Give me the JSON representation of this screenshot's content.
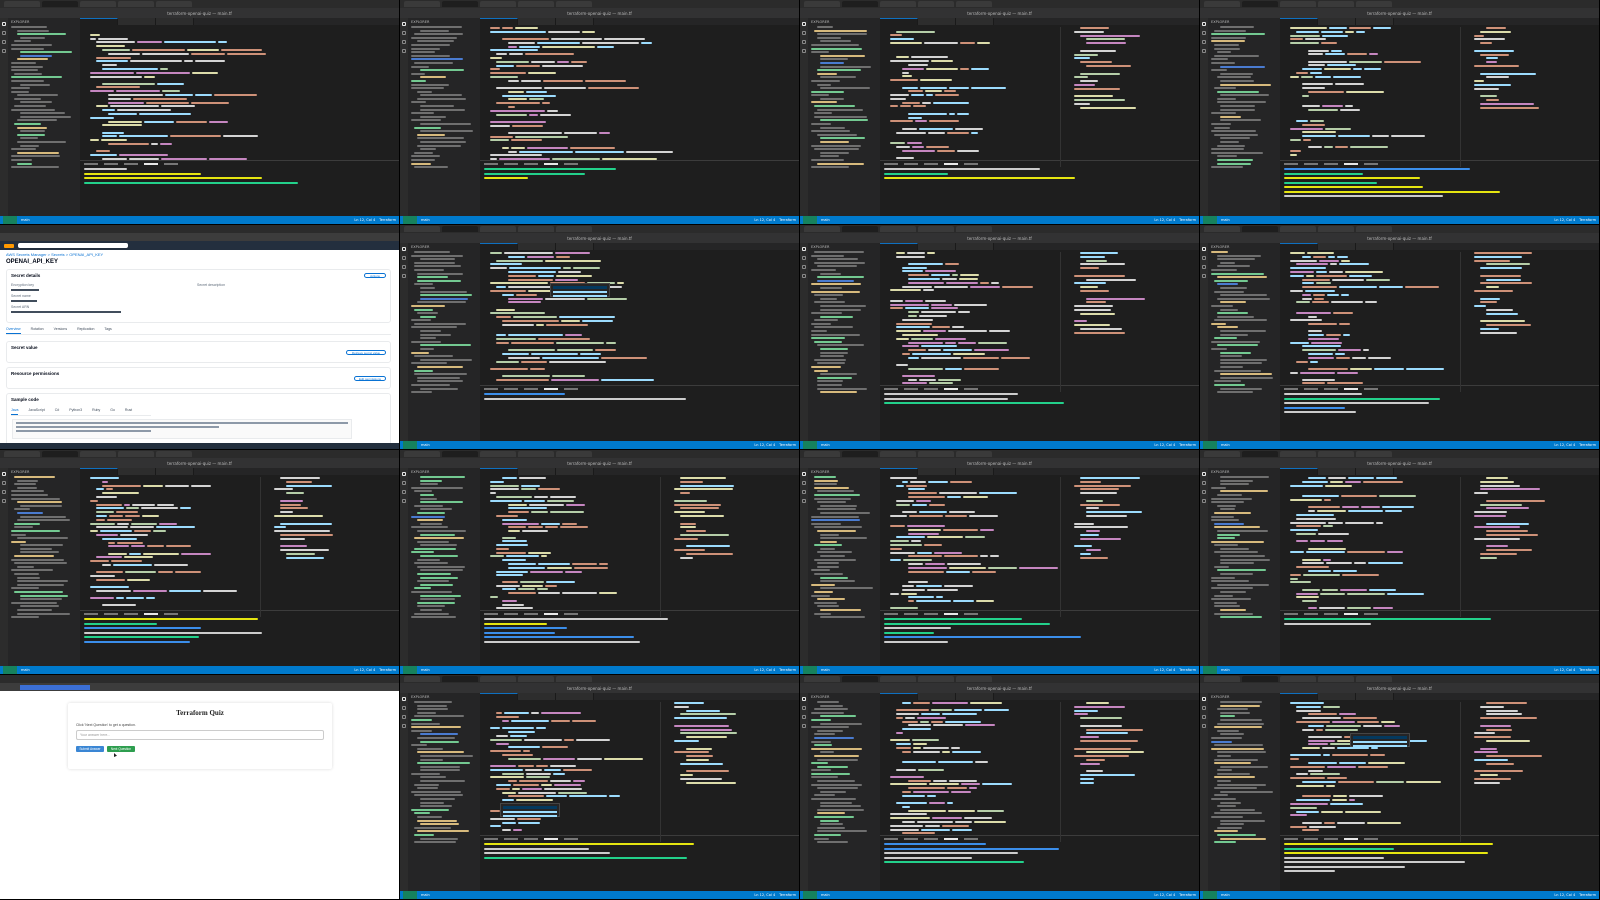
{
  "vscode": {
    "window_title": "terraform-openai-quiz — main.tf",
    "explorer_header": "EXPLORER",
    "status_branch": "main",
    "status_position": "Ln 12, Col 4",
    "status_lang": "Terraform"
  },
  "secret_page": {
    "breadcrumb": "AWS Secrets Manager > Secrets > OPENAI_API_KEY",
    "title": "OPENAI_API_KEY",
    "secret_details_title": "Secret details",
    "encryption_key_label": "Encryption key",
    "secret_name_label": "Secret name",
    "secret_arn_label": "Secret ARN",
    "secret_description_label": "Secret description",
    "actions_button": "Actions",
    "tabs": [
      "Overview",
      "Rotation",
      "Versions",
      "Replication",
      "Tags"
    ],
    "secret_value_title": "Secret value",
    "retrieve_button": "Retrieve secret value",
    "resource_permissions_title": "Resource permissions",
    "edit_permissions_button": "Edit permissions",
    "sample_code_title": "Sample code",
    "sample_code_tabs": [
      "Java",
      "JavaScript",
      "C#",
      "Python3",
      "Ruby",
      "Go",
      "Rust"
    ]
  },
  "quiz_page": {
    "title": "Terraform Quiz",
    "prompt_label": "Click 'Next Question' to get a question.",
    "input_placeholder": "Your answer here...",
    "submit_button": "Submit Answer",
    "next_button": "Next Question"
  }
}
